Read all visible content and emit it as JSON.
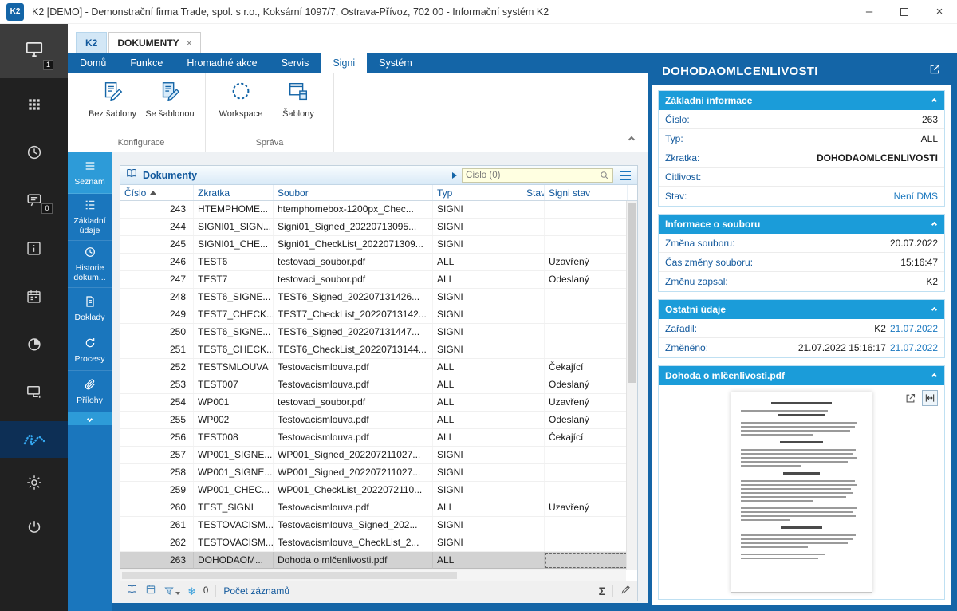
{
  "titlebar": {
    "logo": "K2",
    "title": "K2 [DEMO] - Demonstrační firma Trade, spol. s r.o., Koksární 1097/7, Ostrava-Přívoz, 702 00 - Informační systém K2",
    "controls": {
      "minimize": "–",
      "close": "×"
    }
  },
  "sidebar": {
    "desktop_badge": "1",
    "messages_badge": "0"
  },
  "tabs": {
    "home": "K2",
    "active": "DOKUMENTY",
    "close": "×"
  },
  "menu": {
    "items": [
      "Domů",
      "Funkce",
      "Hromadné akce",
      "Servis",
      "Signi",
      "Systém"
    ],
    "active_index": 4
  },
  "ribbon": {
    "groups": [
      {
        "name": "Konfigurace",
        "buttons": [
          {
            "label": "Bez šablony",
            "icon": "doc-pen"
          },
          {
            "label": "Se šablonou",
            "icon": "doc-pen-filled"
          }
        ]
      },
      {
        "name": "Správa",
        "buttons": [
          {
            "label": "Workspace",
            "icon": "dotted-circle"
          },
          {
            "label": "Šablony",
            "icon": "template"
          }
        ]
      }
    ]
  },
  "nav": {
    "items": [
      "Seznam",
      "Základní údaje",
      "Historie dokum...",
      "Doklady",
      "Procesy",
      "Přílohy"
    ],
    "active_index": 0
  },
  "grid": {
    "title": "Dokumenty",
    "search_value": "Číslo (0)",
    "columns": [
      "Číslo",
      "Zkratka",
      "Soubor",
      "Typ",
      "Stav",
      "Signi stav"
    ],
    "sorted_column_index": 0,
    "selected_row_index": 20,
    "rows": [
      [
        "243",
        "HTEMPHOME...",
        "htemphomebox-1200px_Chec...",
        "SIGNI",
        "",
        ""
      ],
      [
        "244",
        "SIGNI01_SIGN...",
        "Signi01_Signed_20220713095...",
        "SIGNI",
        "",
        ""
      ],
      [
        "245",
        "SIGNI01_CHE...",
        "Signi01_CheckList_2022071309...",
        "SIGNI",
        "",
        ""
      ],
      [
        "246",
        "TEST6",
        "testovaci_soubor.pdf",
        "ALL",
        "",
        "Uzavřený"
      ],
      [
        "247",
        "TEST7",
        "testovaci_soubor.pdf",
        "ALL",
        "",
        "Odeslaný"
      ],
      [
        "248",
        "TEST6_SIGNE...",
        "TEST6_Signed_202207131426...",
        "SIGNI",
        "",
        ""
      ],
      [
        "249",
        "TEST7_CHECK...",
        "TEST7_CheckList_20220713142...",
        "SIGNI",
        "",
        ""
      ],
      [
        "250",
        "TEST6_SIGNE...",
        "TEST6_Signed_202207131447...",
        "SIGNI",
        "",
        ""
      ],
      [
        "251",
        "TEST6_CHECK...",
        "TEST6_CheckList_20220713144...",
        "SIGNI",
        "",
        ""
      ],
      [
        "252",
        "TESTSMLOUVA",
        "Testovacismlouva.pdf",
        "ALL",
        "",
        "Čekající"
      ],
      [
        "253",
        "TEST007",
        "Testovacismlouva.pdf",
        "ALL",
        "",
        "Odeslaný"
      ],
      [
        "254",
        "WP001",
        "testovaci_soubor.pdf",
        "ALL",
        "",
        "Uzavřený"
      ],
      [
        "255",
        "WP002",
        "Testovacismlouva.pdf",
        "ALL",
        "",
        "Odeslaný"
      ],
      [
        "256",
        "TEST008",
        "Testovacismlouva.pdf",
        "ALL",
        "",
        "Čekající"
      ],
      [
        "257",
        "WP001_SIGNE...",
        "WP001_Signed_202207211027...",
        "SIGNI",
        "",
        ""
      ],
      [
        "258",
        "WP001_SIGNE...",
        "WP001_Signed_202207211027...",
        "SIGNI",
        "",
        ""
      ],
      [
        "259",
        "WP001_CHEC...",
        "WP001_CheckList_2022072110...",
        "SIGNI",
        "",
        ""
      ],
      [
        "260",
        "TEST_SIGNI",
        "Testovacismlouva.pdf",
        "ALL",
        "",
        "Uzavřený"
      ],
      [
        "261",
        "TESTOVACISM...",
        "Testovacismlouva_Signed_202...",
        "SIGNI",
        "",
        ""
      ],
      [
        "262",
        "TESTOVACISM...",
        "Testovacismlouva_CheckList_2...",
        "SIGNI",
        "",
        ""
      ],
      [
        "263",
        "DOHODAOM...",
        "Dohoda o mlčenlivosti.pdf",
        "ALL",
        "",
        ""
      ]
    ],
    "statusbar": {
      "pinned_count": "0",
      "records_label": "Počet záznamů",
      "sum_glyph": "Σ",
      "freeze_glyph": "❄"
    }
  },
  "detail": {
    "title": "DOHODAOMLCENLIVOSTI",
    "sections": [
      {
        "header": "Základní informace",
        "rows": [
          {
            "label": "Číslo:",
            "value": "263"
          },
          {
            "label": "Typ:",
            "value": "ALL"
          },
          {
            "label": "Zkratka:",
            "value": "DOHODAOMLCENLIVOSTI",
            "bold": true
          },
          {
            "label": "Citlivost:",
            "value": ""
          },
          {
            "label": "Stav:",
            "value": "",
            "value_blue": "Není DMS"
          }
        ]
      },
      {
        "header": "Informace o souboru",
        "rows": [
          {
            "label": "Změna souboru:",
            "value": "20.07.2022"
          },
          {
            "label": "Čas změny souboru:",
            "value": "15:16:47"
          },
          {
            "label": "Změnu zapsal:",
            "value": "K2"
          }
        ]
      },
      {
        "header": "Ostatní údaje",
        "rows": [
          {
            "label": "Zařadil:",
            "value": "K2",
            "value_blue": "21.07.2022"
          },
          {
            "label": "Změněno:",
            "value": "21.07.2022 15:16:17",
            "value_blue": "21.07.2022"
          }
        ]
      }
    ],
    "preview": {
      "header": "Dohoda o mlčenlivosti.pdf"
    }
  }
}
